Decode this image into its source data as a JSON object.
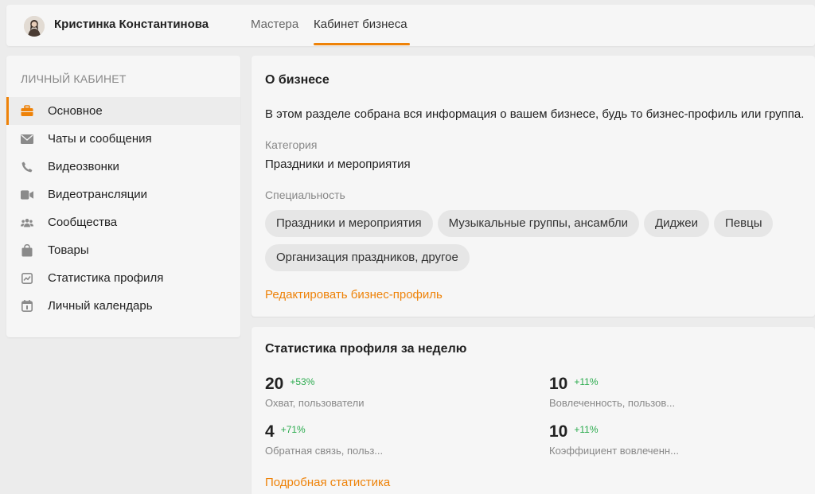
{
  "header": {
    "user_name": "Кристинка Константинова",
    "tabs": [
      {
        "label": "Мастера",
        "active": false
      },
      {
        "label": "Кабинет бизнеса",
        "active": true
      }
    ]
  },
  "sidebar": {
    "heading": "ЛИЧНЫЙ КАБИНЕТ",
    "items": [
      {
        "label": "Основное",
        "icon": "briefcase-icon",
        "active": true
      },
      {
        "label": "Чаты и сообщения",
        "icon": "envelope-icon",
        "active": false
      },
      {
        "label": "Видеозвонки",
        "icon": "phone-icon",
        "active": false
      },
      {
        "label": "Видеотрансляции",
        "icon": "video-camera-icon",
        "active": false
      },
      {
        "label": "Сообщества",
        "icon": "group-icon",
        "active": false
      },
      {
        "label": "Товары",
        "icon": "shopping-bag-icon",
        "active": false
      },
      {
        "label": "Статистика профиля",
        "icon": "chart-icon",
        "active": false
      },
      {
        "label": "Личный календарь",
        "icon": "calendar-icon",
        "active": false
      }
    ]
  },
  "business": {
    "title": "О бизнесе",
    "description": "В этом разделе собрана вся информация о вашем бизнесе, будь то бизнес-профиль или группа.",
    "category_label": "Категория",
    "category_value": "Праздники и мероприятия",
    "specialty_label": "Специальность",
    "specialties": [
      "Праздники и мероприятия",
      "Музыкальные группы, ансамбли",
      "Диджеи",
      "Певцы",
      "Организация праздников, другое"
    ],
    "edit_link": "Редактировать бизнес-профиль"
  },
  "stats": {
    "title": "Статистика профиля за неделю",
    "items": [
      {
        "value": "20",
        "delta": "+53%",
        "label": "Охват, пользователи"
      },
      {
        "value": "10",
        "delta": "+11%",
        "label": "Вовлеченность, пользов..."
      },
      {
        "value": "4",
        "delta": "+71%",
        "label": "Обратная связь, польз..."
      },
      {
        "value": "10",
        "delta": "+11%",
        "label": "Коэффициент вовлеченн..."
      }
    ],
    "details_link": "Подробная статистика"
  },
  "colors": {
    "accent": "#ee8208",
    "positive": "#2bab4e",
    "icon": "#8a8a8a"
  }
}
